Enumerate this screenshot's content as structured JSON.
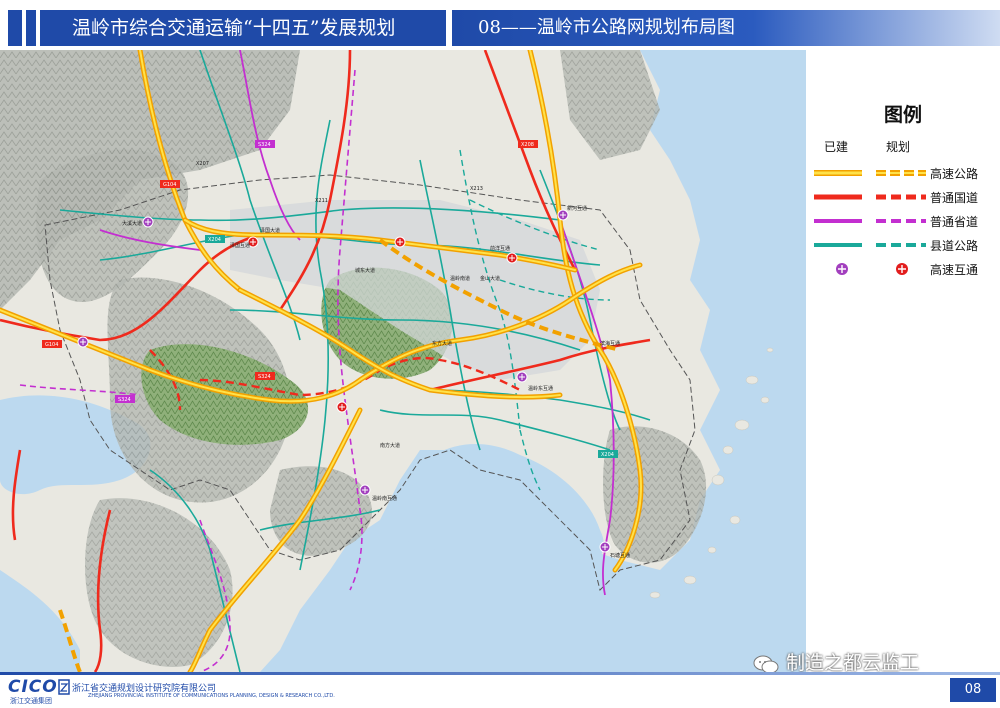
{
  "header": {
    "title": "温岭市综合交通运输“十四五”发展规划",
    "subtitle": "08——温岭市公路网规划布局图"
  },
  "legend": {
    "title": "图例",
    "col_built": "已建",
    "col_planned": "规划",
    "items": [
      {
        "label": "高速公路",
        "color": "#f2a100",
        "inner": "#ffe24a",
        "icon": "expressway-line"
      },
      {
        "label": "普通国道",
        "color": "#ef2a1d",
        "icon": "national-road-line"
      },
      {
        "label": "普通省道",
        "color": "#c32fd0",
        "icon": "provincial-road-line"
      },
      {
        "label": "县道公路",
        "color": "#1aa99a",
        "icon": "county-road-line"
      },
      {
        "label": "高速互通",
        "color": "#a23fbe",
        "planned_color": "#e21d1d",
        "icon": "interchange-icon"
      }
    ]
  },
  "map_labels": {
    "g104": "G104",
    "g104b": "G104",
    "s324": "S324",
    "s324b": "S324",
    "s324c": "S324",
    "x204": "X204",
    "x204b": "X204",
    "x208": "X208",
    "x207": "X207",
    "x211": "X211",
    "x213": "X213",
    "zeguo_road": "泽国大道",
    "daxi_road": "大溪大道",
    "cx_road": "城东大道",
    "wenling_east": "温岭东互通",
    "wenling_south": "温岭南互通",
    "wenling_nan": "温岭南道",
    "qianyang": "前洋互通",
    "zeguo_ic": "泽国互通",
    "dongfang": "东方大道",
    "jinshan": "金山大道",
    "nanfang": "南方大道",
    "shitang": "石塘互通",
    "xinhe": "新河互通",
    "binhai": "滨海互通"
  },
  "footer": {
    "cico": "CICO",
    "cico_sub": "浙江交通集团",
    "inst": "浙江省交通规划设计研究院有限公司",
    "inst_en": "ZHEJIANG PROVINCIAL INSTITUTE OF COMMUNICATIONS PLANNING, DESIGN & RESEARCH CO.,LTD.",
    "zjic": "ZJIC",
    "page": "08"
  },
  "watermark": "制造之都云监工",
  "colors": {
    "brand_blue": "#1f4aa8",
    "sea": "#bcd9ef",
    "land": "#e8e8e0",
    "hill": "#9aa39a",
    "forest": "#7ea66a",
    "urban": "#d6dadc"
  }
}
